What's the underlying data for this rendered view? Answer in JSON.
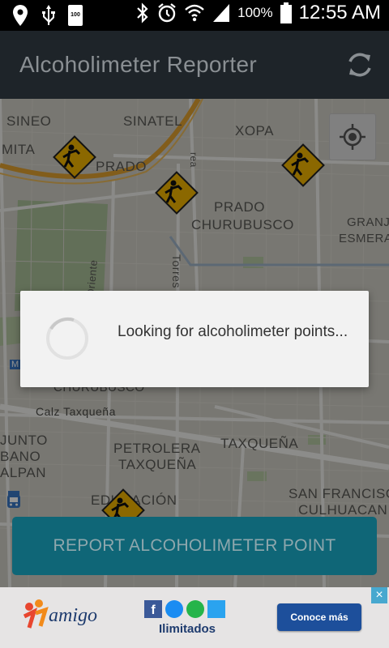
{
  "status_bar": {
    "battery_percent": "100%",
    "battery_icon_label": "100",
    "time": "12:55 AM"
  },
  "app_bar": {
    "title": "Alcoholimeter Reporter"
  },
  "map": {
    "labels": {
      "sineo": "SINEO",
      "sinatel": "SINATEL",
      "xopa": "XOPA",
      "mita": "MITA",
      "prado_top": "PRADO",
      "prado": "PRADO",
      "churubusco": "CHURUBUSCO",
      "granj": "GRANJ",
      "esmera": "ESMERA",
      "oriente": "Oriente",
      "torres": "Torres",
      "rea": "rea",
      "calz_taxquena": "Calz Taxqueña",
      "churubusco_lower": "CHURUBUSCO",
      "junto": "JUNTO",
      "bano": "BANO",
      "alpan": "ALPAN",
      "petrolera": "PETROLERA",
      "taxquena_lower": "TAXQUEÑA",
      "taxquena": "TAXQUEÑA",
      "educacion": "EDUCACIÓN",
      "san_francisco": "SAN FRANCISCO",
      "culhuacan": "CULHUACAN",
      "metro_m": "M"
    }
  },
  "dialog": {
    "message": "Looking for alcoholimeter points..."
  },
  "report_button": {
    "label": "REPORT ALCOHOLIMETER POINT"
  },
  "ad": {
    "brand": "amigo",
    "subtitle": "Ilimitados",
    "cta": "Conoce más",
    "close": "×"
  }
}
